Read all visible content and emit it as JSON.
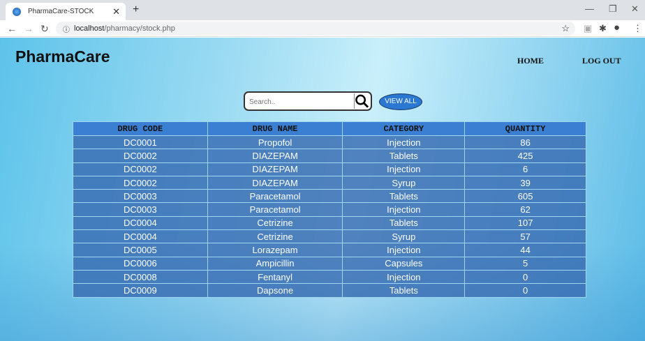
{
  "browser": {
    "tab_title": "PharmaCare-STOCK",
    "url_host": "localhost",
    "url_path": "/pharmacy/stock.php"
  },
  "header": {
    "brand": "PharmaCare",
    "nav": [
      "HOME",
      "LOG OUT"
    ]
  },
  "search": {
    "placeholder": "Search..",
    "value": "",
    "view_all_label": "VIEW ALL"
  },
  "table": {
    "columns": [
      "DRUG CODE",
      "DRUG NAME",
      "CATEGORY",
      "QUANTITY"
    ],
    "rows": [
      [
        "DC0001",
        "Propofol",
        "Injection",
        "86"
      ],
      [
        "DC0002",
        "DIAZEPAM",
        "Tablets",
        "425"
      ],
      [
        "DC0002",
        "DIAZEPAM",
        "Injection",
        "6"
      ],
      [
        "DC0002",
        "DIAZEPAM",
        "Syrup",
        "39"
      ],
      [
        "DC0003",
        "Paracetamol",
        "Tablets",
        "605"
      ],
      [
        "DC0003",
        "Paracetamol",
        "Injection",
        "62"
      ],
      [
        "DC0004",
        "Cetrizine",
        "Tablets",
        "107"
      ],
      [
        "DC0004",
        "Cetrizine",
        "Syrup",
        "57"
      ],
      [
        "DC0005",
        "Lorazepam",
        "Injection",
        "44"
      ],
      [
        "DC0006",
        "Ampicillin",
        "Capsules",
        "5"
      ],
      [
        "DC0008",
        "Fentanyl",
        "Injection",
        "0"
      ],
      [
        "DC0009",
        "Dapsone",
        "Tablets",
        "0"
      ]
    ]
  },
  "colors": {
    "header_bg": "#3b7fd2",
    "row_bg": "#3a6eb4",
    "button": "#2a78d2"
  }
}
